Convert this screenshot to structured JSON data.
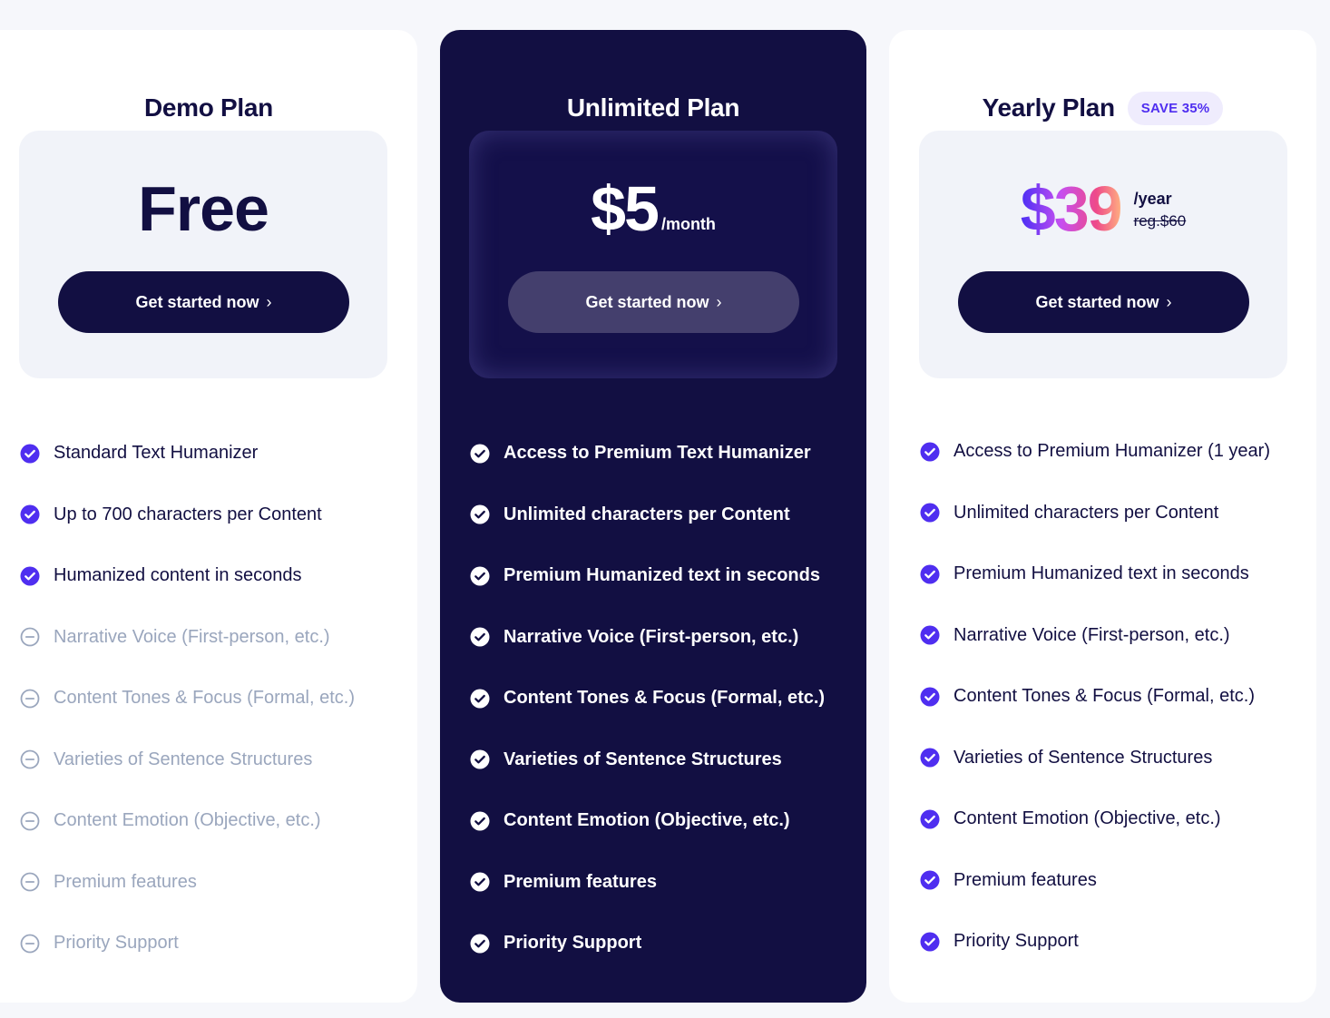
{
  "colors": {
    "navy": "#120f42",
    "accent": "#4f2ef0",
    "muted": "#9aa6bd",
    "badge_bg": "#efecfd"
  },
  "plans": [
    {
      "title": "Demo Plan",
      "price": "Free",
      "cta_label": "Get started now",
      "cta_icon": "chevron-right-icon",
      "features": [
        {
          "label": "Standard Text Humanizer",
          "included": true
        },
        {
          "label": "Up to 700 characters per Content",
          "included": true
        },
        {
          "label": "Humanized content in seconds",
          "included": true
        },
        {
          "label": "Narrative Voice (First-person, etc.)",
          "included": false
        },
        {
          "label": "Content Tones & Focus (Formal, etc.)",
          "included": false
        },
        {
          "label": "Varieties of Sentence Structures",
          "included": false
        },
        {
          "label": "Content Emotion (Objective, etc.)",
          "included": false
        },
        {
          "label": "Premium features",
          "included": false
        },
        {
          "label": "Priority Support",
          "included": false
        }
      ]
    },
    {
      "title": "Unlimited Plan",
      "price": "$5",
      "period": "/month",
      "cta_label": "Get started now",
      "cta_icon": "chevron-right-icon",
      "features": [
        {
          "label": "Access to Premium Text Humanizer",
          "included": true
        },
        {
          "label": "Unlimited characters per Content",
          "included": true
        },
        {
          "label": "Premium Humanized text in seconds",
          "included": true
        },
        {
          "label": "Narrative Voice (First-person, etc.)",
          "included": true
        },
        {
          "label": "Content Tones & Focus (Formal, etc.)",
          "included": true
        },
        {
          "label": "Varieties of Sentence Structures",
          "included": true
        },
        {
          "label": "Content Emotion (Objective, etc.)",
          "included": true
        },
        {
          "label": "Premium features",
          "included": true
        },
        {
          "label": "Priority Support",
          "included": true
        }
      ]
    },
    {
      "title": "Yearly Plan",
      "badge": "SAVE 35%",
      "price": "$39",
      "period": "/year",
      "regular_price": "reg.$60",
      "cta_label": "Get started now",
      "cta_icon": "chevron-right-icon",
      "features": [
        {
          "label": "Access to Premium Humanizer (1 year)",
          "included": true
        },
        {
          "label": "Unlimited characters per Content",
          "included": true
        },
        {
          "label": "Premium Humanized text in seconds",
          "included": true
        },
        {
          "label": "Narrative Voice (First-person, etc.)",
          "included": true
        },
        {
          "label": "Content Tones & Focus (Formal, etc.)",
          "included": true
        },
        {
          "label": "Varieties of Sentence Structures",
          "included": true
        },
        {
          "label": "Content Emotion (Objective, etc.)",
          "included": true
        },
        {
          "label": "Premium features",
          "included": true
        },
        {
          "label": "Priority Support",
          "included": true
        }
      ]
    }
  ]
}
